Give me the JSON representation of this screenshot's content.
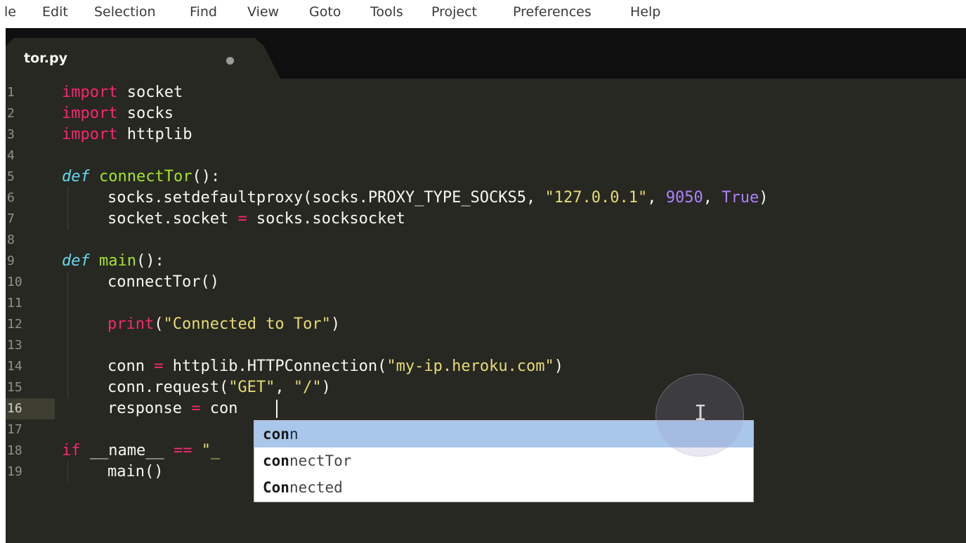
{
  "menu": [
    "le",
    "Edit",
    "Selection",
    "Find",
    "View",
    "Goto",
    "Tools",
    "Project",
    "Preferences",
    "Help"
  ],
  "tab": {
    "title": "tor.py"
  },
  "gutter": [
    "1",
    "2",
    "3",
    "4",
    "5",
    "6",
    "7",
    "8",
    "9",
    "10",
    "11",
    "12",
    "13",
    "14",
    "15",
    "16",
    "17",
    "18",
    "19"
  ],
  "code": {
    "l1": {
      "kw": "import",
      "rest": " socket"
    },
    "l2": {
      "kw": "import",
      "rest": " socks"
    },
    "l3": {
      "kw": "import",
      "rest": " httplib"
    },
    "l5": {
      "def": "def",
      "sp": " ",
      "fn": "connectTor",
      "rest": "():"
    },
    "l6": {
      "a": "socks.setdefaultproxy(socks.PROXY_TYPE_SOCKS5, ",
      "s": "\"127.0.0.1\"",
      "c1": ", ",
      "n": "9050",
      "c2": ", ",
      "b": "True",
      "e": ")"
    },
    "l7": {
      "a": "socket.socket ",
      "op": "=",
      "b": " socks.socksocket"
    },
    "l9": {
      "def": "def",
      "sp": " ",
      "fn": "main",
      "rest": "():"
    },
    "l10": {
      "a": "connectTor()"
    },
    "l12": {
      "p": "print",
      "a": "(",
      "s": "\"Connected to Tor\"",
      "e": ")"
    },
    "l14": {
      "a": "conn ",
      "op": "=",
      "b": " httplib.HTTPConnection(",
      "s": "\"my-ip.heroku.com\"",
      "e": ")"
    },
    "l15": {
      "a": "conn.request(",
      "s1": "\"GET\"",
      "c": ", ",
      "s2": "\"/\"",
      "e": ")"
    },
    "l16": {
      "a": "response ",
      "op": "=",
      "b": " con"
    },
    "l18": {
      "kw": "if",
      "a": " __name__ ",
      "op": "==",
      "s": " \"_"
    },
    "l19": {
      "a": "main()"
    }
  },
  "autocomplete": [
    {
      "match": "con",
      "rest": "n"
    },
    {
      "match": "con",
      "rest": "nectTor"
    },
    {
      "match": "Con",
      "rest": "nected"
    }
  ],
  "colors": {
    "background": "#272822",
    "keyword": "#f92672",
    "function": "#a6e22e",
    "string": "#e6db74",
    "number": "#ae81ff",
    "builtin": "#66d9ef",
    "selection": "#a9c7ea"
  }
}
